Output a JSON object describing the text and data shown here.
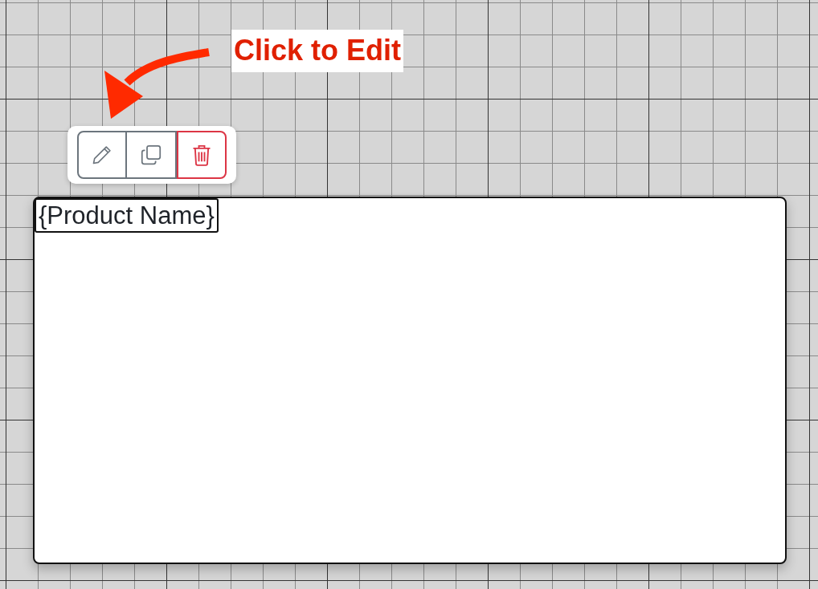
{
  "annotation": {
    "text": "Click to Edit"
  },
  "toolbar": {
    "buttons": [
      {
        "kind": "edit"
      },
      {
        "kind": "duplicate"
      },
      {
        "kind": "delete"
      }
    ]
  },
  "element": {
    "field": "{Product Name}"
  }
}
